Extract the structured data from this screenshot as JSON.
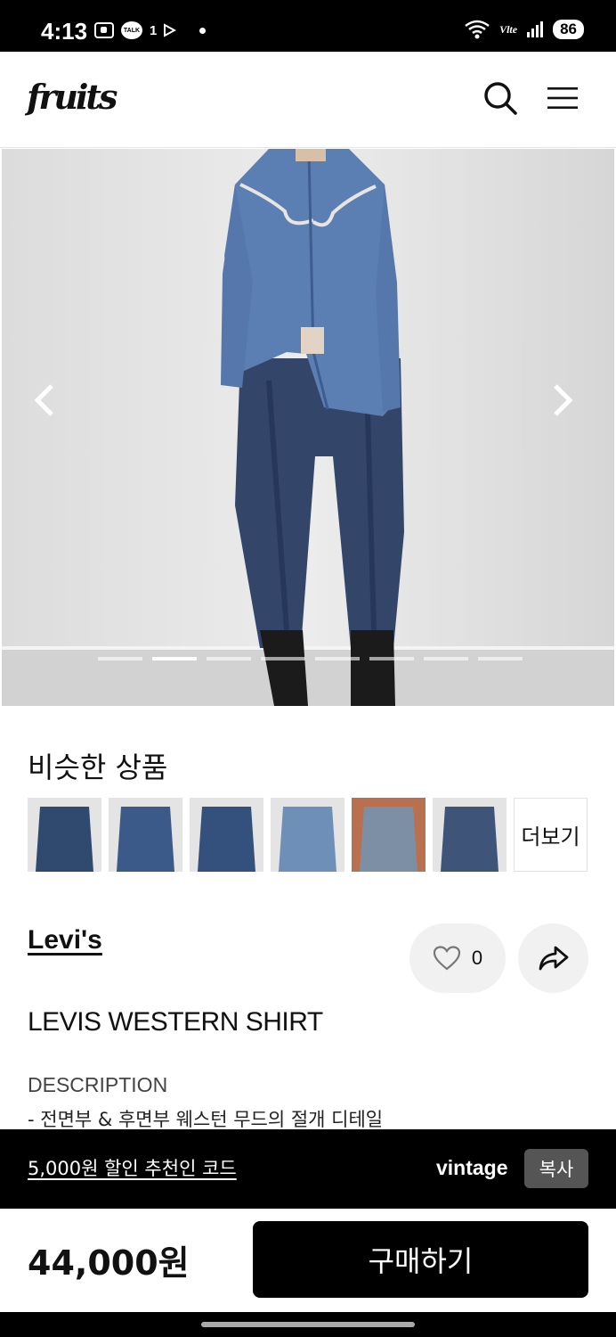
{
  "status_bar": {
    "time": "4:13",
    "talk_label": "TALK",
    "notification_count": "1",
    "network_label": "Vlte",
    "battery": "86"
  },
  "header": {
    "logo": "fruits"
  },
  "gallery": {
    "image_count": 8,
    "active_index": 1
  },
  "similar": {
    "title": "비슷한 상품",
    "more_label": "더보기",
    "thumb_colors": [
      "#2f4a6e",
      "#3b5a8a",
      "#34507d",
      "#6e90b8",
      "#7d8fa4",
      "#3e5478"
    ]
  },
  "product": {
    "brand": "Levi's",
    "like_count": "0",
    "name": "LEVIS WESTERN SHIRT",
    "description_label": "DESCRIPTION",
    "description_line": "- 전면부 & 후면부 웨스턴 무드의 절개 디테일"
  },
  "referral": {
    "text": "5,000원 할인 추천인 코드",
    "code": "vintage",
    "copy_label": "복사"
  },
  "purchase": {
    "price": "44,000원",
    "buy_label": "구매하기"
  }
}
